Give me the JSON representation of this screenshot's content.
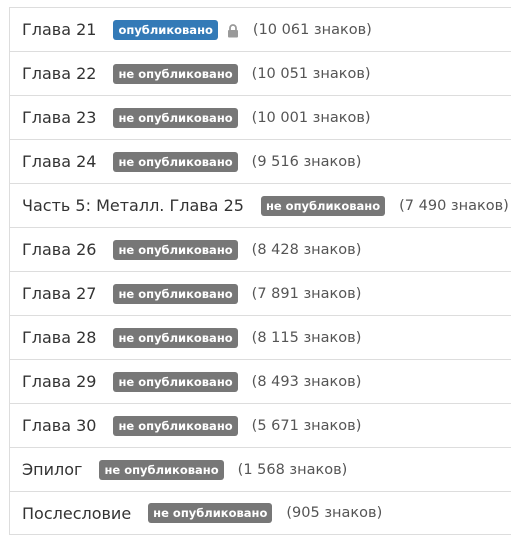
{
  "colors": {
    "badge_published": "#337ab7",
    "badge_unpublished": "#777777",
    "text": "#333333",
    "row_border": "#dddddd"
  },
  "chapters": [
    {
      "title": "Глава 21",
      "status": "опубликовано",
      "published": true,
      "locked": true,
      "count": "(10 061 знаков)"
    },
    {
      "title": "Глава 22",
      "status": "не опубликовано",
      "published": false,
      "locked": false,
      "count": "(10 051 знаков)"
    },
    {
      "title": "Глава 23",
      "status": "не опубликовано",
      "published": false,
      "locked": false,
      "count": "(10 001 знаков)"
    },
    {
      "title": "Глава 24",
      "status": "не опубликовано",
      "published": false,
      "locked": false,
      "count": "(9 516 знаков)"
    },
    {
      "title": "Часть 5: Металл. Глава 25",
      "status": "не опубликовано",
      "published": false,
      "locked": false,
      "count": "(7 490 знаков)"
    },
    {
      "title": "Глава 26",
      "status": "не опубликовано",
      "published": false,
      "locked": false,
      "count": "(8 428 знаков)"
    },
    {
      "title": "Глава 27",
      "status": "не опубликовано",
      "published": false,
      "locked": false,
      "count": "(7 891 знаков)"
    },
    {
      "title": "Глава 28",
      "status": "не опубликовано",
      "published": false,
      "locked": false,
      "count": "(8 115 знаков)"
    },
    {
      "title": "Глава 29",
      "status": "не опубликовано",
      "published": false,
      "locked": false,
      "count": "(8 493 знаков)"
    },
    {
      "title": "Глава 30",
      "status": "не опубликовано",
      "published": false,
      "locked": false,
      "count": "(5 671 знаков)"
    },
    {
      "title": "Эпилог",
      "status": "не опубликовано",
      "published": false,
      "locked": false,
      "count": "(1 568 знаков)"
    },
    {
      "title": "Послесловие",
      "status": "не опубликовано",
      "published": false,
      "locked": false,
      "count": "(905 знаков)"
    }
  ]
}
